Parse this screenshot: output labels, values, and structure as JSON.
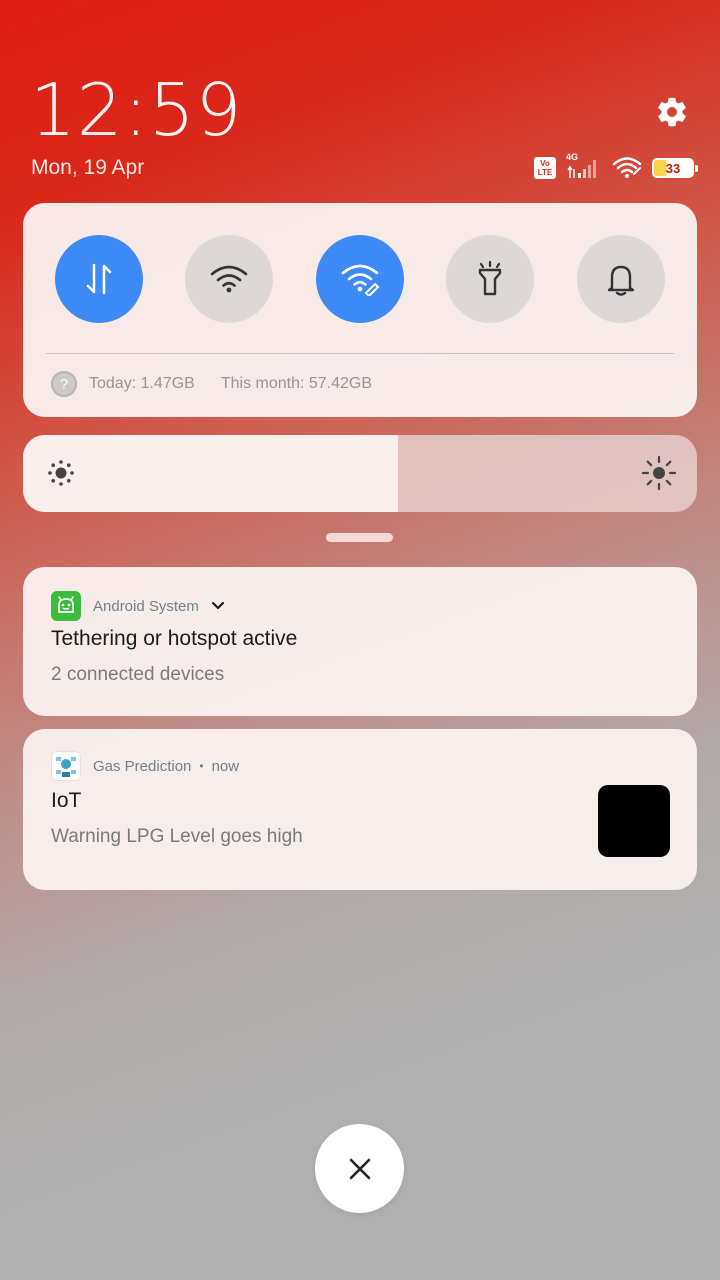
{
  "header": {
    "time": "12:59",
    "date": "Mon, 19 Apr"
  },
  "status_bar": {
    "volte_label": "Vo LTE",
    "network_type": "4G",
    "battery_level": "33"
  },
  "quick_settings": {
    "tiles": [
      {
        "icon": "mobile-data-icon",
        "active": true
      },
      {
        "icon": "wifi-icon",
        "active": false
      },
      {
        "icon": "hotspot-icon",
        "active": true
      },
      {
        "icon": "flashlight-icon",
        "active": false
      },
      {
        "icon": "bell-icon",
        "active": false
      }
    ],
    "usage_today": "Today: 1.47GB",
    "usage_month": "This month: 57.42GB"
  },
  "brightness": {
    "level": 0.557
  },
  "notifications": [
    {
      "app_name": "Android System",
      "title": "Tethering or hotspot active",
      "body": "2 connected devices"
    },
    {
      "app_name": "Gas Prediction",
      "separator": "•",
      "time": "now",
      "title": "IoT",
      "body": "Warning LPG Level goes high"
    }
  ],
  "colors": {
    "accent": "#3d8af7",
    "status_red": "#d8281a"
  }
}
